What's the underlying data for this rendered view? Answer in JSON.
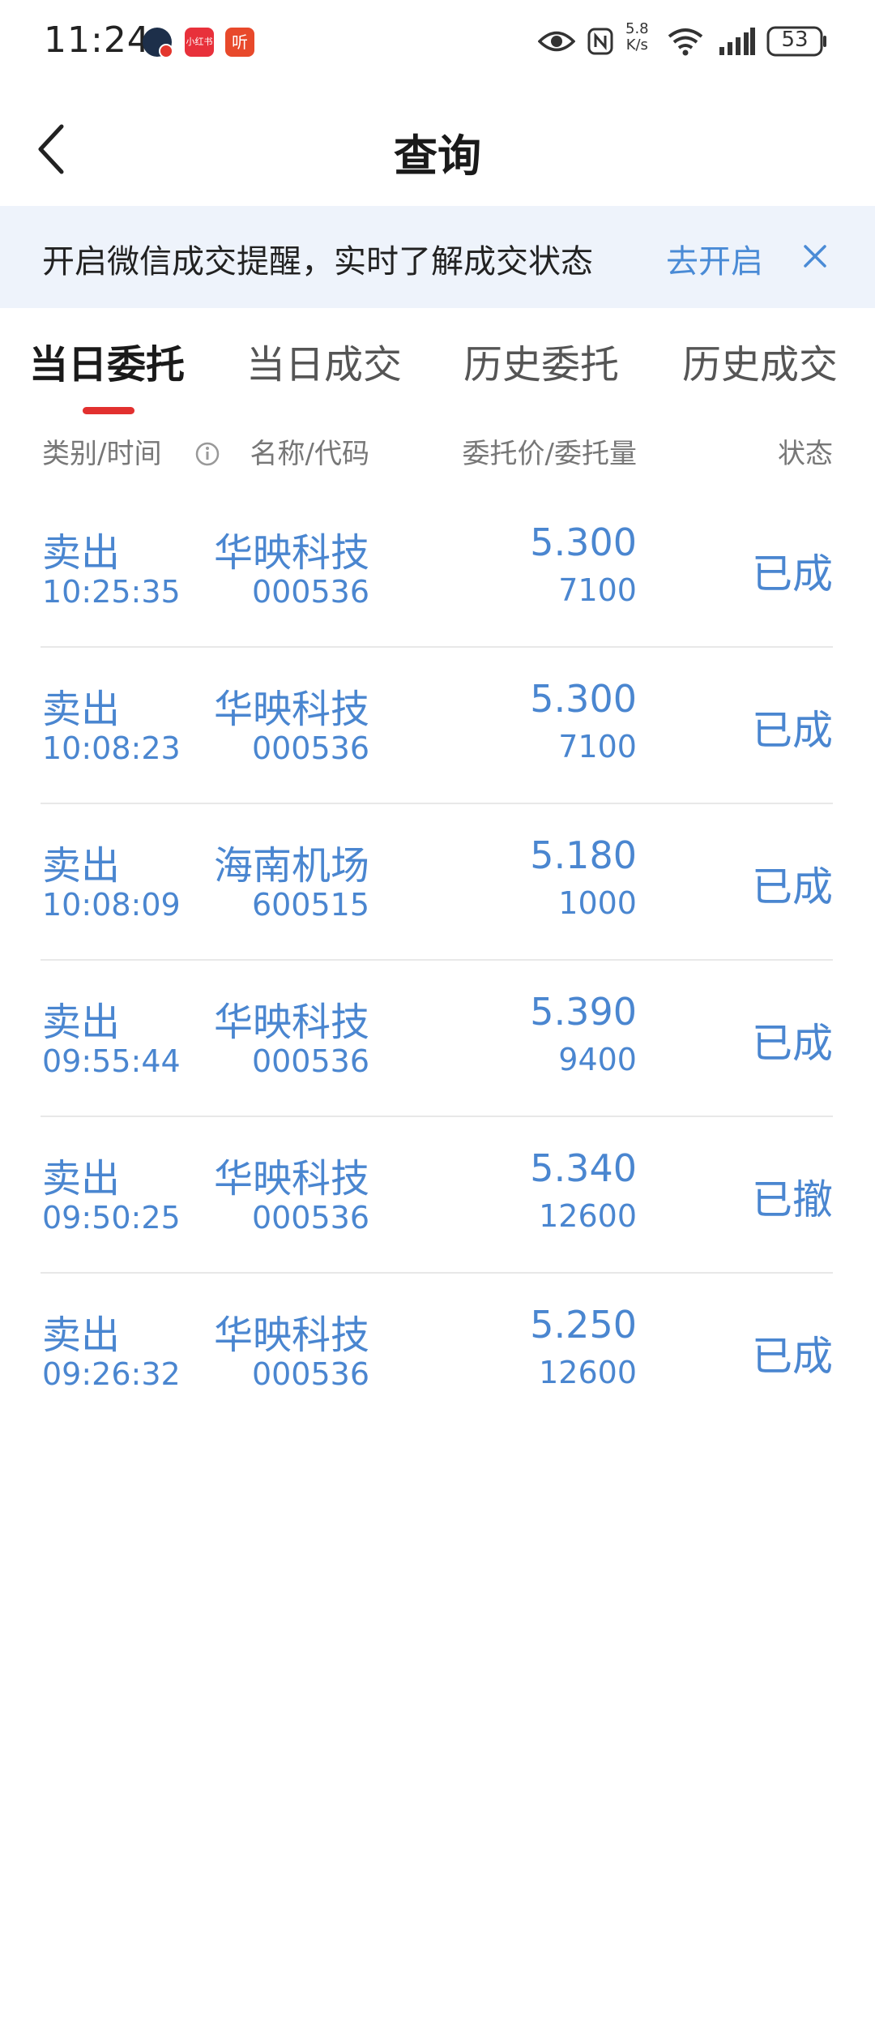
{
  "status_bar": {
    "time": "11:24",
    "app_icons": [
      "avatar-icon",
      "xiaohongshu-icon",
      "listen-app-icon"
    ],
    "red_app_label": "小红书",
    "listen_app_label": "听",
    "net_speed_value": "5.8",
    "net_speed_unit": "K/s",
    "battery": "53"
  },
  "nav": {
    "title": "查询"
  },
  "banner": {
    "text": "开启微信成交提醒，实时了解成交状态",
    "link": "去开启"
  },
  "tabs": [
    {
      "label": "当日委托",
      "active": true
    },
    {
      "label": "当日成交",
      "active": false
    },
    {
      "label": "历史委托",
      "active": false
    },
    {
      "label": "历史成交",
      "active": false
    }
  ],
  "header": {
    "type_time": "类别/时间",
    "name_code": "名称/代码",
    "price_qty": "委托价/委托量",
    "status": "状态"
  },
  "orders": [
    {
      "type": "卖出",
      "time": "10:25:35",
      "name": "华映科技",
      "code": "000536",
      "price": "5.300",
      "qty": "7100",
      "status": "已成"
    },
    {
      "type": "卖出",
      "time": "10:08:23",
      "name": "华映科技",
      "code": "000536",
      "price": "5.300",
      "qty": "7100",
      "status": "已成"
    },
    {
      "type": "卖出",
      "time": "10:08:09",
      "name": "海南机场",
      "code": "600515",
      "price": "5.180",
      "qty": "1000",
      "status": "已成"
    },
    {
      "type": "卖出",
      "time": "09:55:44",
      "name": "华映科技",
      "code": "000536",
      "price": "5.390",
      "qty": "9400",
      "status": "已成"
    },
    {
      "type": "卖出",
      "time": "09:50:25",
      "name": "华映科技",
      "code": "000536",
      "price": "5.340",
      "qty": "12600",
      "status": "已撤"
    },
    {
      "type": "卖出",
      "time": "09:26:32",
      "name": "华映科技",
      "code": "000536",
      "price": "5.250",
      "qty": "12600",
      "status": "已成"
    }
  ],
  "colors": {
    "accent_blue": "#4a86d0",
    "tab_indicator": "#e2302f",
    "banner_bg": "#eef3fb"
  }
}
